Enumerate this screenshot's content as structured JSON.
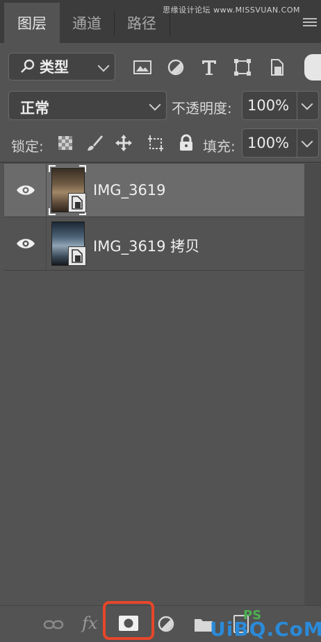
{
  "tabs": [
    {
      "label": "图层",
      "active": true
    },
    {
      "label": "通道",
      "active": false
    },
    {
      "label": "路径",
      "active": false
    }
  ],
  "watermark": "思缘设计论坛 www.MISSVUAN.COM",
  "filter": {
    "label": "类型",
    "icons": [
      "image-filter-icon",
      "adjustment-filter-icon",
      "type-filter-icon",
      "shape-filter-icon",
      "smart-object-filter-icon"
    ]
  },
  "blend": {
    "mode": "正常",
    "opacity_label": "不透明度:",
    "opacity_value": "100%"
  },
  "lock": {
    "label": "锁定:",
    "fill_label": "填充:",
    "fill_value": "100%"
  },
  "layers": [
    {
      "name": "IMG_3619",
      "selected": true,
      "visible": true
    },
    {
      "name": "IMG_3619 拷贝",
      "selected": false,
      "visible": true
    }
  ],
  "bottom_toolbar": {
    "fx_label": "fx",
    "logo_ps": "PS",
    "logo_site": "UiBQ.CoM"
  },
  "colors": {
    "panel": "#535353",
    "selected_row": "#6b6b6b",
    "highlight": "#e8462a",
    "logo": "#2b8ad8"
  }
}
